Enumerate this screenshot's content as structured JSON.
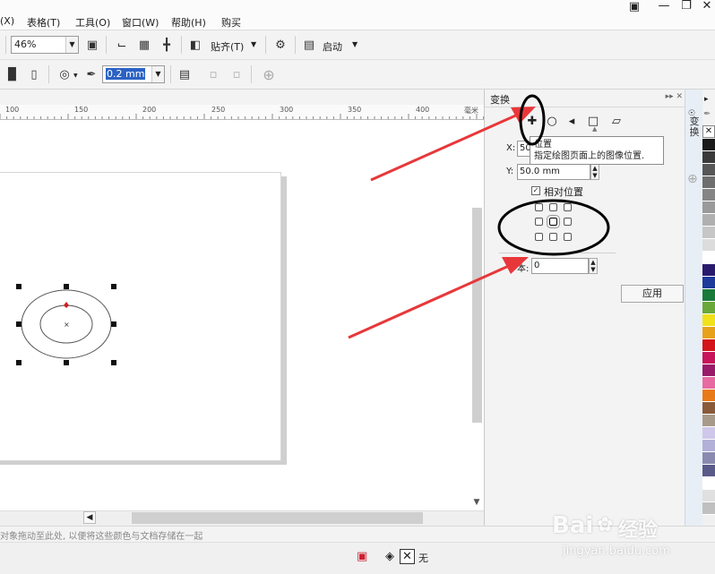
{
  "menu": {
    "items": [
      "(X)",
      "表格(T)",
      "工具(O)",
      "窗口(W)",
      "帮助(H)",
      "购买"
    ]
  },
  "toolbar1": {
    "zoom": "46%",
    "snap_label": "贴齐(T)",
    "launch_label": "启动"
  },
  "toolbar2": {
    "outline_width": "0.2 mm"
  },
  "ruler": {
    "labels": [
      "100",
      "150",
      "200",
      "250",
      "300",
      "350",
      "400"
    ],
    "unit": "毫米"
  },
  "docker": {
    "title": "变换",
    "x_label": "X:",
    "x_value": "50",
    "y_label": "Y:",
    "y_value": "50.0 mm",
    "relative_position_label": "相对位置",
    "copies_label": "本:",
    "copies_value": "0",
    "apply_label": "应用",
    "tooltip_title": "位置",
    "tooltip_text": "指定绘图页面上的图像位置."
  },
  "side_tab": {
    "label": "变换"
  },
  "statusbar": {
    "hint": "对象拖动至此处, 以便将这些颜色与文档存储在一起",
    "fill_none_label": "无"
  },
  "watermark": {
    "brand": "Bai",
    "brand2": "经验",
    "url": "jingyan.baidu.com"
  },
  "palette": {
    "colors": [
      "#1a1a1a",
      "#3a3a3a",
      "#575757",
      "#6e6e6e",
      "#858585",
      "#9a9a9a",
      "#b0b0b0",
      "#c6c6c6",
      "#dcdcdc",
      "#ffffff",
      "#2a1a6e",
      "#1e3a9a",
      "#1a7a3a",
      "#6aa83a",
      "#f0e11a",
      "#e8a21a",
      "#d4141a",
      "#c8145a",
      "#9a1a6a",
      "#e86aa2",
      "#e87a1a",
      "#8a5a3a",
      "#a89a8a",
      "#cfc8ea",
      "#b2b0d8",
      "#8a8ab0",
      "#5a5a8a",
      "#ffffff",
      "#e0e0e0",
      "#c0c0c0"
    ]
  },
  "colors": {
    "annotation_red": "#e8373a",
    "selection_marker": "#cc1f1f"
  }
}
